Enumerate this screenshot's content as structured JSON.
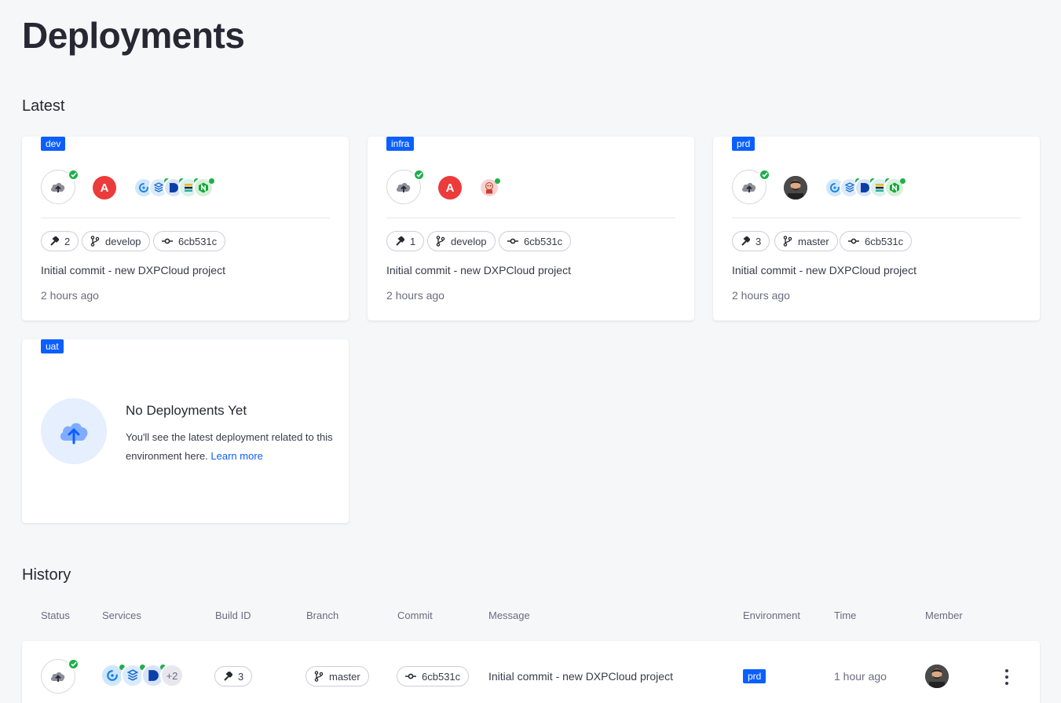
{
  "page": {
    "title": "Deployments"
  },
  "latest": {
    "title": "Latest",
    "cards": [
      {
        "env": "dev",
        "build": "2",
        "branch": "develop",
        "commit": "6cb531c",
        "message": "Initial commit - new DXPCloud project",
        "time": "2 hours ago",
        "avatar": "A"
      },
      {
        "env": "infra",
        "build": "1",
        "branch": "develop",
        "commit": "6cb531c",
        "message": "Initial commit - new DXPCloud project",
        "time": "2 hours ago",
        "avatar": "A"
      },
      {
        "env": "prd",
        "build": "3",
        "branch": "master",
        "commit": "6cb531c",
        "message": "Initial commit - new DXPCloud project",
        "time": "2 hours ago"
      }
    ],
    "empty": {
      "env": "uat",
      "title": "No Deployments Yet",
      "desc": "You'll see the latest deployment related to this environment here.",
      "link": "Learn more"
    }
  },
  "history": {
    "title": "History",
    "columns": [
      "Status",
      "Services",
      "Build ID",
      "Branch",
      "Commit",
      "Message",
      "Environment",
      "Time",
      "Member"
    ],
    "rows": [
      {
        "more": "+2",
        "build": "3",
        "branch": "master",
        "commit": "6cb531c",
        "message": "Initial commit - new DXPCloud project",
        "env": "prd",
        "time": "1 hour ago"
      }
    ]
  },
  "colors": {
    "accent": "#0b5fff",
    "success": "#1faf4b",
    "danger": "#ec3b3b"
  },
  "icons": [
    "cloud-upload-icon",
    "check-icon",
    "hammer-icon",
    "branch-icon",
    "commit-icon",
    "kebab-icon"
  ]
}
